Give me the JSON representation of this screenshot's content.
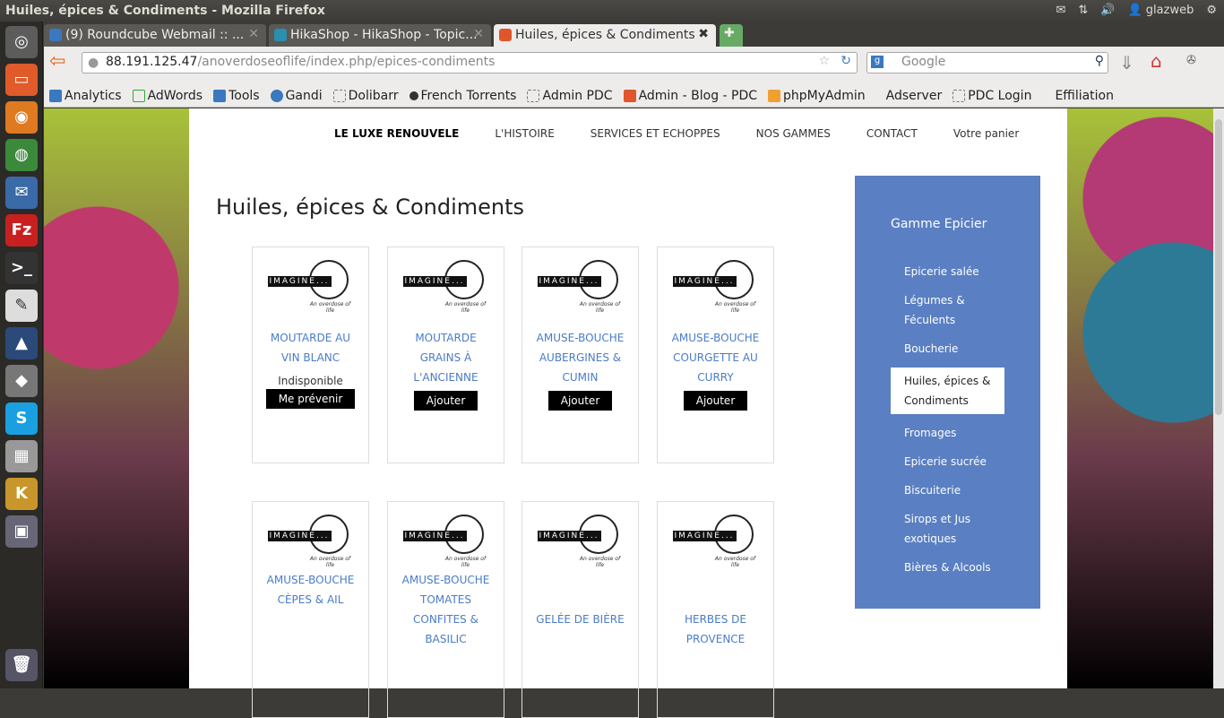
{
  "window": {
    "title": "Huiles, épices & Condiments - Mozilla Firefox",
    "user": "glazweb"
  },
  "tabs": [
    {
      "label": "(9) Roundcube Webmail :: ...",
      "color": "#3a78c0"
    },
    {
      "label": "HikaShop - HikaShop - Topic...",
      "color": "#2b8fb0"
    },
    {
      "label": "Huiles, épices & Condiments",
      "color": "#e0552b"
    }
  ],
  "navbar": {
    "url_host": "88.191.125.47",
    "url_path": "/anoverdoseoflife/index.php/epices-condiments",
    "search_placeholder": "Google"
  },
  "bookmarks": [
    "Analytics",
    "AdWords",
    "Tools",
    "Gandi",
    "Dolibarr",
    "French Torrents",
    "Admin PDC",
    "Admin - Blog - PDC",
    "phpMyAdmin",
    "Adserver",
    "PDC Login",
    "Effiliation"
  ],
  "site": {
    "menu": [
      "LE LUXE RENOUVELE",
      "L'HISTOIRE",
      "SERVICES ET ECHOPPES",
      "NOS GAMMES",
      "CONTACT",
      "Votre panier"
    ],
    "title": "Huiles, épices & Condiments",
    "logo": {
      "word": "IMAGINE...",
      "tagline": "An overdose of life"
    },
    "products": [
      {
        "name": "MOUTARDE AU VIN BLANC",
        "status": "Indisponible",
        "button": "Me prévenir"
      },
      {
        "name": "MOUTARDE GRAINS À L'ANCIENNE",
        "button": "Ajouter"
      },
      {
        "name": "AMUSE-BOUCHE AUBERGINES & CUMIN",
        "button": "Ajouter"
      },
      {
        "name": "AMUSE-BOUCHE COURGETTE AU CURRY",
        "button": "Ajouter"
      },
      {
        "name": "AMUSE-BOUCHE CÈPES & AIL"
      },
      {
        "name": "AMUSE-BOUCHE TOMATES CONFITES & BASILIC"
      },
      {
        "name": "GELÉE DE BIÈRE"
      },
      {
        "name": "HERBES DE PROVENCE"
      }
    ],
    "sidebar": {
      "title": "Gamme Epicier",
      "items": [
        "Epicerie salée",
        "Légumes & Féculents",
        "Boucherie",
        "Huiles, épices & Condiments",
        "Fromages",
        "Epicerie sucrée",
        "Biscuiterie",
        "Sirops et Jus exotiques",
        "Bières & Alcools"
      ],
      "active": 3
    }
  }
}
